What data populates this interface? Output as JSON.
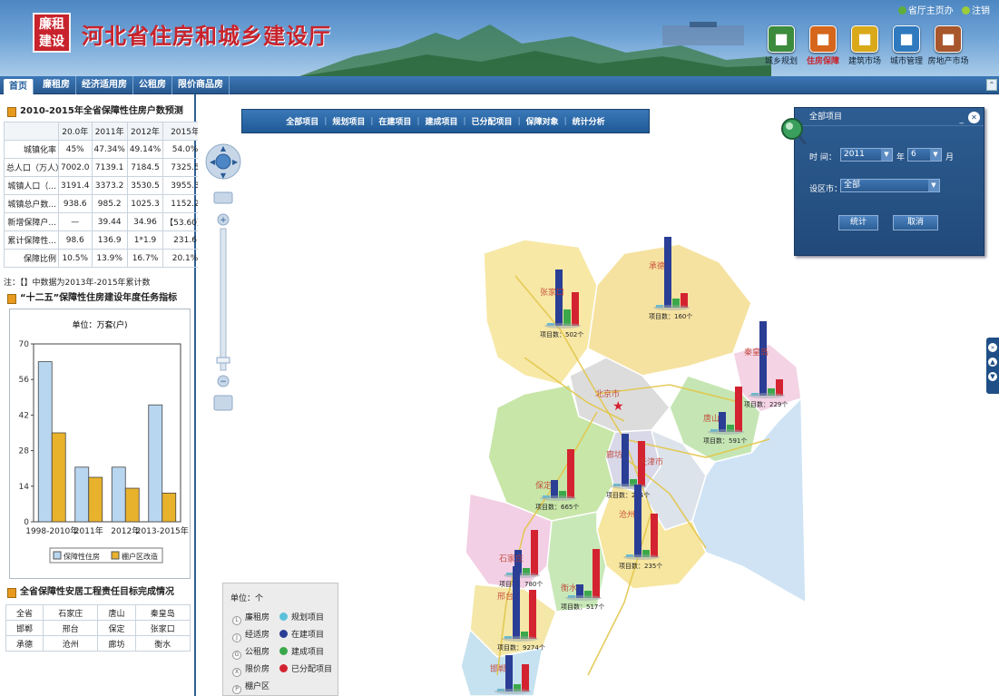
{
  "header": {
    "logo_text": "廉租\n建设",
    "title": "河北省住房和城乡建设厅",
    "top_links": [
      "省厅主页办",
      "注销"
    ],
    "modules": [
      {
        "label": "城乡规划",
        "icon": "planning-icon",
        "color": "#3d8b3d"
      },
      {
        "label": "住房保障",
        "icon": "housing-security-icon",
        "color": "#d6661c"
      },
      {
        "label": "建筑市场",
        "icon": "construction-market-icon",
        "color": "#d9a91a"
      },
      {
        "label": "城市管理",
        "icon": "city-management-icon",
        "color": "#2f79bf"
      },
      {
        "label": "房地产市场",
        "icon": "real-estate-icon",
        "color": "#a8562c"
      }
    ],
    "active_module": 1
  },
  "nav": {
    "tabs": [
      "首页",
      "廉租房",
      "经济适用房",
      "公租房",
      "限价商品房"
    ],
    "active": 0
  },
  "left": {
    "forecast_title": "2010-2015年全省保障性住房户数预测",
    "forecast_headers": [
      "",
      "20.0年",
      "2011年",
      "2012年",
      "2015年"
    ],
    "forecast_rows": [
      [
        "城镇化率",
        "45%",
        "47.34%",
        "49.14%",
        "54.0%"
      ],
      [
        "总人口（万人）",
        "7002.0",
        "7139.1",
        "7184.5",
        "7325.5"
      ],
      [
        "城镇人口（...",
        "3191.4",
        "3373.2",
        "3530.5",
        "3955.3"
      ],
      [
        "城镇总户数...",
        "938.6",
        "985.2",
        "1025.3",
        "1152.2"
      ],
      [
        "新增保障户...",
        "—",
        "39.44",
        "34.96",
        "【53.60】"
      ],
      [
        "累计保障性...",
        "98.6",
        "136.9",
        "1*1.9",
        "231.6"
      ],
      [
        "保障比例",
        "10.5%",
        "13.9%",
        "16.7%",
        "20.1%"
      ]
    ],
    "forecast_note": "注：【】中数据为2013年-2015年累计数",
    "task_title": "“十二五”保障性住房建设年度任务指标",
    "goal_title": "全省保障性安居工程责任目标完成情况",
    "goal_cities": [
      [
        "全省",
        "石家庄",
        "唐山",
        "秦皇岛"
      ],
      [
        "邯郸",
        "邢台",
        "保定",
        "张家口"
      ],
      [
        "承德",
        "沧州",
        "廊坊",
        "衡水"
      ]
    ]
  },
  "chart_data": {
    "type": "bar",
    "title": "单位：万套(户)",
    "categories": [
      "1998-2010年",
      "2011年",
      "2012年",
      "2013-2015年"
    ],
    "series": [
      {
        "name": "保障性住房",
        "values": [
          63,
          21.5,
          21.5,
          46
        ],
        "color": "#b8d6f0"
      },
      {
        "name": "棚户区改造",
        "values": [
          35,
          17.5,
          13.2,
          11.3
        ],
        "color": "#e8b22c"
      }
    ],
    "yticks": [
      "0",
      "14",
      "28",
      "42",
      "56",
      "70"
    ],
    "ylim": [
      0,
      70
    ],
    "legend": "bottom"
  },
  "map": {
    "menu": [
      "全部项目",
      "规划项目",
      "在建项目",
      "建成项目",
      "已分配项目",
      "保障对象",
      "统计分析"
    ],
    "filter": {
      "title": "全部项目",
      "time_label": "时  间：",
      "year": "2011",
      "year_unit": "年",
      "month": "6",
      "month_unit": "月",
      "city_label": "设区市：",
      "city": "全部",
      "stat_btn": "统计",
      "cancel_btn": "取消"
    },
    "legend": {
      "unit": "单位：个",
      "types": [
        {
          "label": "廉租房",
          "glyph": "L"
        },
        {
          "label": "经适房",
          "glyph": "J"
        },
        {
          "label": "公租房",
          "glyph": "G"
        },
        {
          "label": "限价房",
          "glyph": "X"
        },
        {
          "label": "棚户区",
          "glyph": "P"
        }
      ],
      "statuses": [
        {
          "label": "规划项目",
          "color": "#5bc0d9"
        },
        {
          "label": "在建项目",
          "color": "#2a3e96"
        },
        {
          "label": "建成项目",
          "color": "#3aa84a"
        },
        {
          "label": "已分配项目",
          "color": "#d42330"
        }
      ]
    },
    "cities": [
      {
        "name": "张家口",
        "count": "项目数：502个",
        "bars": [
          3,
          62,
          18,
          37
        ]
      },
      {
        "name": "承德",
        "count": "项目数：160个",
        "bars": [
          3,
          78,
          10,
          16
        ]
      },
      {
        "name": "秦皇岛",
        "count": "项目数：229个",
        "bars": [
          3,
          82,
          8,
          18
        ]
      },
      {
        "name": "唐山",
        "count": "项目数：591个",
        "bars": [
          3,
          22,
          8,
          50
        ]
      },
      {
        "name": "北京市",
        "count": "",
        "bars": []
      },
      {
        "name": "廊坊",
        "count": "项目数：244个",
        "bars": [
          3,
          58,
          8,
          50
        ]
      },
      {
        "name": "天津市",
        "count": "",
        "bars": []
      },
      {
        "name": "保定",
        "count": "项目数：665个",
        "bars": [
          3,
          20,
          8,
          54
        ]
      },
      {
        "name": "沧州",
        "count": "项目数：235个",
        "bars": [
          3,
          80,
          8,
          48
        ]
      },
      {
        "name": "石家庄",
        "count": "项目数：780个",
        "bars": [
          3,
          28,
          8,
          50
        ]
      },
      {
        "name": "衡水",
        "count": "项目数：517个",
        "bars": [
          3,
          15,
          8,
          54
        ]
      },
      {
        "name": "邢台",
        "count": "项目数：9274个",
        "bars": [
          3,
          80,
          8,
          54
        ]
      },
      {
        "name": "邯郸",
        "count": "",
        "bars": [
          3,
          40,
          8,
          30
        ]
      }
    ]
  }
}
